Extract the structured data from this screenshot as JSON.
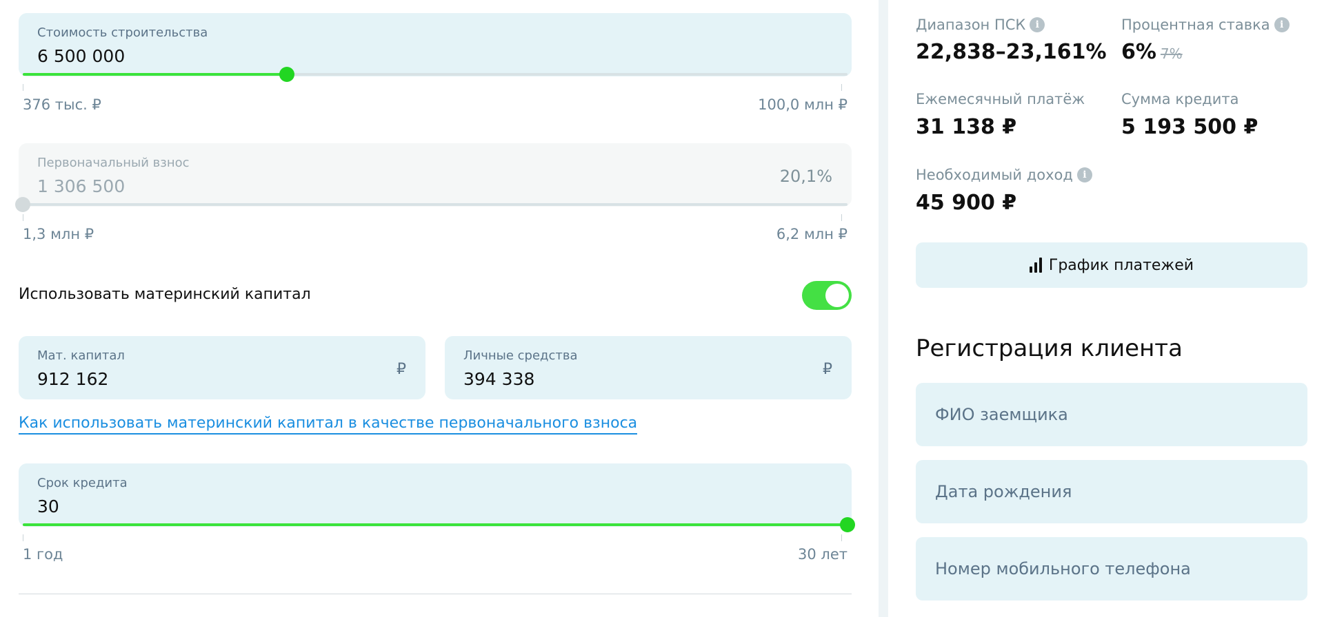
{
  "construction": {
    "label": "Стоимость строительства",
    "value": "6 500 000",
    "min_label": "376 тыс. ₽",
    "max_label": "100,0 млн ₽",
    "progress": 0.32
  },
  "down_payment": {
    "label": "Первоначальный взнос",
    "value": "1 306 500",
    "percent": "20,1%",
    "min_label": "1,3 млн ₽",
    "max_label": "6,2 млн ₽",
    "progress": 0.0
  },
  "mat_capital_toggle": {
    "label": "Использовать материнский капитал",
    "on": true
  },
  "mat_capital": {
    "label": "Мат. капитал",
    "value": "912 162",
    "currency": "₽"
  },
  "own_funds": {
    "label": "Личные средства",
    "value": "394 338",
    "currency": "₽"
  },
  "help_link": "Как использовать материнский капитал в качестве первоначального взноса",
  "term": {
    "label": "Срок кредита",
    "value": "30",
    "min_label": "1 год",
    "max_label": "30 лет",
    "progress": 1.0
  },
  "summary": {
    "psk_label": "Диапазон ПСК",
    "psk_value": "22,838–23,161%",
    "rate_label": "Процентная ставка",
    "rate_value": "6%",
    "rate_old": "7%",
    "monthly_label": "Ежемесячный платёж",
    "monthly_value": "31 138 ₽",
    "loan_label": "Сумма кредита",
    "loan_value": "5 193 500 ₽",
    "income_label": "Необходимый доход",
    "income_value": "45 900 ₽",
    "info_glyph": "i"
  },
  "schedule_button": "График платежей",
  "registration": {
    "title": "Регистрация клиента",
    "fields": [
      "ФИО заемщика",
      "Дата рождения",
      "Номер мобильного телефона"
    ]
  },
  "colors": {
    "accent_green": "#22d622",
    "field_bg": "#e4f3f7",
    "link_blue": "#1a8ee0"
  }
}
